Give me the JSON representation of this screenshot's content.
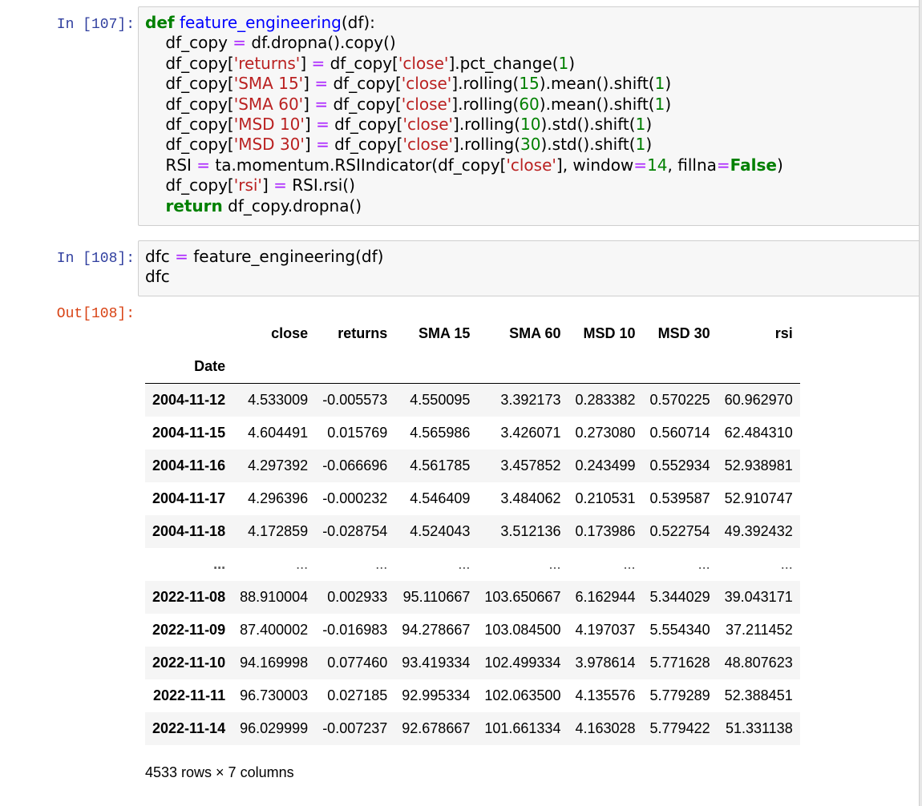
{
  "cells": [
    {
      "prompt": "In [107]:",
      "code_lines": [
        [
          [
            "kw",
            "def"
          ],
          [
            "t",
            " "
          ],
          [
            "fn",
            "feature_engineering"
          ],
          [
            "t",
            "(df):"
          ]
        ],
        [
          [
            "t",
            "    df_copy "
          ],
          [
            "op",
            "="
          ],
          [
            "t",
            " df.dropna().copy()"
          ]
        ],
        [
          [
            "t",
            "    df_copy["
          ],
          [
            "str",
            "'returns'"
          ],
          [
            "t",
            "] "
          ],
          [
            "op",
            "="
          ],
          [
            "t",
            " df_copy["
          ],
          [
            "str",
            "'close'"
          ],
          [
            "t",
            "].pct_change("
          ],
          [
            "num",
            "1"
          ],
          [
            "t",
            ")"
          ]
        ],
        [
          [
            "t",
            "    df_copy["
          ],
          [
            "str",
            "'SMA 15'"
          ],
          [
            "t",
            "] "
          ],
          [
            "op",
            "="
          ],
          [
            "t",
            " df_copy["
          ],
          [
            "str",
            "'close'"
          ],
          [
            "t",
            "].rolling("
          ],
          [
            "num",
            "15"
          ],
          [
            "t",
            ").mean().shift("
          ],
          [
            "num",
            "1"
          ],
          [
            "t",
            ")"
          ]
        ],
        [
          [
            "t",
            "    df_copy["
          ],
          [
            "str",
            "'SMA 60'"
          ],
          [
            "t",
            "] "
          ],
          [
            "op",
            "="
          ],
          [
            "t",
            " df_copy["
          ],
          [
            "str",
            "'close'"
          ],
          [
            "t",
            "].rolling("
          ],
          [
            "num",
            "60"
          ],
          [
            "t",
            ").mean().shift("
          ],
          [
            "num",
            "1"
          ],
          [
            "t",
            ")"
          ]
        ],
        [
          [
            "t",
            "    df_copy["
          ],
          [
            "str",
            "'MSD 10'"
          ],
          [
            "t",
            "] "
          ],
          [
            "op",
            "="
          ],
          [
            "t",
            " df_copy["
          ],
          [
            "str",
            "'close'"
          ],
          [
            "t",
            "].rolling("
          ],
          [
            "num",
            "10"
          ],
          [
            "t",
            ").std().shift("
          ],
          [
            "num",
            "1"
          ],
          [
            "t",
            ")"
          ]
        ],
        [
          [
            "t",
            "    df_copy["
          ],
          [
            "str",
            "'MSD 30'"
          ],
          [
            "t",
            "] "
          ],
          [
            "op",
            "="
          ],
          [
            "t",
            " df_copy["
          ],
          [
            "str",
            "'close'"
          ],
          [
            "t",
            "].rolling("
          ],
          [
            "num",
            "30"
          ],
          [
            "t",
            ").std().shift("
          ],
          [
            "num",
            "1"
          ],
          [
            "t",
            ")"
          ]
        ],
        [
          [
            "t",
            "    RSI "
          ],
          [
            "op",
            "="
          ],
          [
            "t",
            " ta.momentum.RSIIndicator(df_copy["
          ],
          [
            "str",
            "'close'"
          ],
          [
            "t",
            "], window"
          ],
          [
            "op",
            "="
          ],
          [
            "num",
            "14"
          ],
          [
            "t",
            ", fillna"
          ],
          [
            "op",
            "="
          ],
          [
            "kw",
            "False"
          ],
          [
            "t",
            ")"
          ]
        ],
        [
          [
            "t",
            "    df_copy["
          ],
          [
            "str",
            "'rsi'"
          ],
          [
            "t",
            "] "
          ],
          [
            "op",
            "="
          ],
          [
            "t",
            " RSI.rsi()"
          ]
        ],
        [
          [
            "t",
            "    "
          ],
          [
            "kw",
            "return"
          ],
          [
            "t",
            " df_copy.dropna()"
          ]
        ]
      ]
    },
    {
      "prompt": "In [108]:",
      "code_lines": [
        [
          [
            "t",
            "dfc "
          ],
          [
            "op",
            "="
          ],
          [
            "t",
            " feature_engineering(df)"
          ]
        ],
        [
          [
            "t",
            "dfc"
          ]
        ]
      ]
    }
  ],
  "output": {
    "prompt": "Out[108]:",
    "table": {
      "columns": [
        "close",
        "returns",
        "SMA 15",
        "SMA 60",
        "MSD 10",
        "MSD 30",
        "rsi"
      ],
      "index_name": "Date",
      "rows": [
        {
          "index": "2004-11-12",
          "values": [
            "4.533009",
            "-0.005573",
            "4.550095",
            "3.392173",
            "0.283382",
            "0.570225",
            "60.962970"
          ]
        },
        {
          "index": "2004-11-15",
          "values": [
            "4.604491",
            "0.015769",
            "4.565986",
            "3.426071",
            "0.273080",
            "0.560714",
            "62.484310"
          ]
        },
        {
          "index": "2004-11-16",
          "values": [
            "4.297392",
            "-0.066696",
            "4.561785",
            "3.457852",
            "0.243499",
            "0.552934",
            "52.938981"
          ]
        },
        {
          "index": "2004-11-17",
          "values": [
            "4.296396",
            "-0.000232",
            "4.546409",
            "3.484062",
            "0.210531",
            "0.539587",
            "52.910747"
          ]
        },
        {
          "index": "2004-11-18",
          "values": [
            "4.172859",
            "-0.028754",
            "4.524043",
            "3.512136",
            "0.173986",
            "0.522754",
            "49.392432"
          ]
        },
        {
          "index": "...",
          "values": [
            "...",
            "...",
            "...",
            "...",
            "...",
            "...",
            "..."
          ],
          "ellipsis": true
        },
        {
          "index": "2022-11-08",
          "values": [
            "88.910004",
            "0.002933",
            "95.110667",
            "103.650667",
            "6.162944",
            "5.344029",
            "39.043171"
          ]
        },
        {
          "index": "2022-11-09",
          "values": [
            "87.400002",
            "-0.016983",
            "94.278667",
            "103.084500",
            "4.197037",
            "5.554340",
            "37.211452"
          ]
        },
        {
          "index": "2022-11-10",
          "values": [
            "94.169998",
            "0.077460",
            "93.419334",
            "102.499334",
            "3.978614",
            "5.771628",
            "48.807623"
          ]
        },
        {
          "index": "2022-11-11",
          "values": [
            "96.730003",
            "0.027185",
            "92.995334",
            "102.063500",
            "4.135576",
            "5.779289",
            "52.388451"
          ]
        },
        {
          "index": "2022-11-14",
          "values": [
            "96.029999",
            "-0.007237",
            "92.678667",
            "101.661334",
            "4.163028",
            "5.779422",
            "51.331138"
          ]
        }
      ]
    },
    "shape_text": "4533 rows × 7 columns"
  }
}
